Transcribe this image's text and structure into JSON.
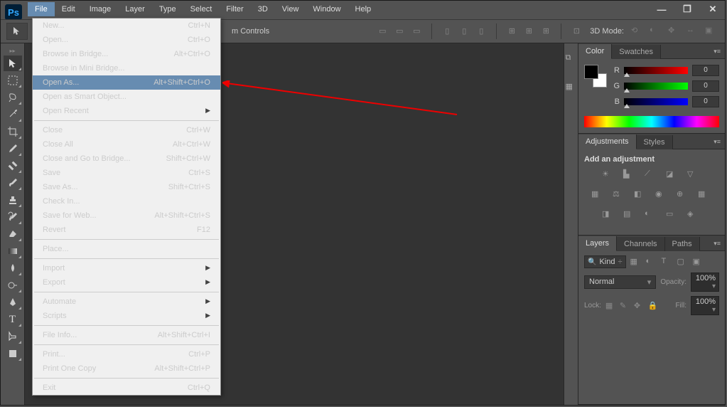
{
  "app": {
    "logo": "Ps"
  },
  "menubar": [
    "File",
    "Edit",
    "Image",
    "Layer",
    "Type",
    "Select",
    "Filter",
    "3D",
    "View",
    "Window",
    "Help"
  ],
  "options": {
    "controls_label": "m Controls",
    "mode3d_label": "3D Mode:"
  },
  "file_menu": [
    {
      "label": "New...",
      "shortcut": "Ctrl+N"
    },
    {
      "label": "Open...",
      "shortcut": "Ctrl+O"
    },
    {
      "label": "Browse in Bridge...",
      "shortcut": "Alt+Ctrl+O"
    },
    {
      "label": "Browse in Mini Bridge...",
      "shortcut": ""
    },
    {
      "label": "Open As...",
      "shortcut": "Alt+Shift+Ctrl+O",
      "highlight": true
    },
    {
      "label": "Open as Smart Object...",
      "shortcut": ""
    },
    {
      "label": "Open Recent",
      "shortcut": "",
      "submenu": true
    },
    {
      "sep": true
    },
    {
      "label": "Close",
      "shortcut": "Ctrl+W"
    },
    {
      "label": "Close All",
      "shortcut": "Alt+Ctrl+W"
    },
    {
      "label": "Close and Go to Bridge...",
      "shortcut": "Shift+Ctrl+W"
    },
    {
      "label": "Save",
      "shortcut": "Ctrl+S"
    },
    {
      "label": "Save As...",
      "shortcut": "Shift+Ctrl+S"
    },
    {
      "label": "Check In...",
      "shortcut": ""
    },
    {
      "label": "Save for Web...",
      "shortcut": "Alt+Shift+Ctrl+S"
    },
    {
      "label": "Revert",
      "shortcut": "F12"
    },
    {
      "sep": true
    },
    {
      "label": "Place...",
      "shortcut": ""
    },
    {
      "sep": true
    },
    {
      "label": "Import",
      "shortcut": "",
      "submenu": true
    },
    {
      "label": "Export",
      "shortcut": "",
      "submenu": true
    },
    {
      "sep": true
    },
    {
      "label": "Automate",
      "shortcut": "",
      "submenu": true
    },
    {
      "label": "Scripts",
      "shortcut": "",
      "submenu": true
    },
    {
      "sep": true
    },
    {
      "label": "File Info...",
      "shortcut": "Alt+Shift+Ctrl+I"
    },
    {
      "sep": true
    },
    {
      "label": "Print...",
      "shortcut": "Ctrl+P"
    },
    {
      "label": "Print One Copy",
      "shortcut": "Alt+Shift+Ctrl+P"
    },
    {
      "sep": true
    },
    {
      "label": "Exit",
      "shortcut": "Ctrl+Q"
    }
  ],
  "color_panel": {
    "tabs": [
      "Color",
      "Swatches"
    ],
    "r": {
      "label": "R",
      "value": "0"
    },
    "g": {
      "label": "G",
      "value": "0"
    },
    "b": {
      "label": "B",
      "value": "0"
    }
  },
  "adjustments_panel": {
    "tabs": [
      "Adjustments",
      "Styles"
    ],
    "title": "Add an adjustment"
  },
  "layers_panel": {
    "tabs": [
      "Layers",
      "Channels",
      "Paths"
    ],
    "kind": "Kind",
    "blend": "Normal",
    "opacity_label": "Opacity:",
    "opacity_value": "100%",
    "lock_label": "Lock:",
    "fill_label": "Fill:",
    "fill_value": "100%"
  }
}
